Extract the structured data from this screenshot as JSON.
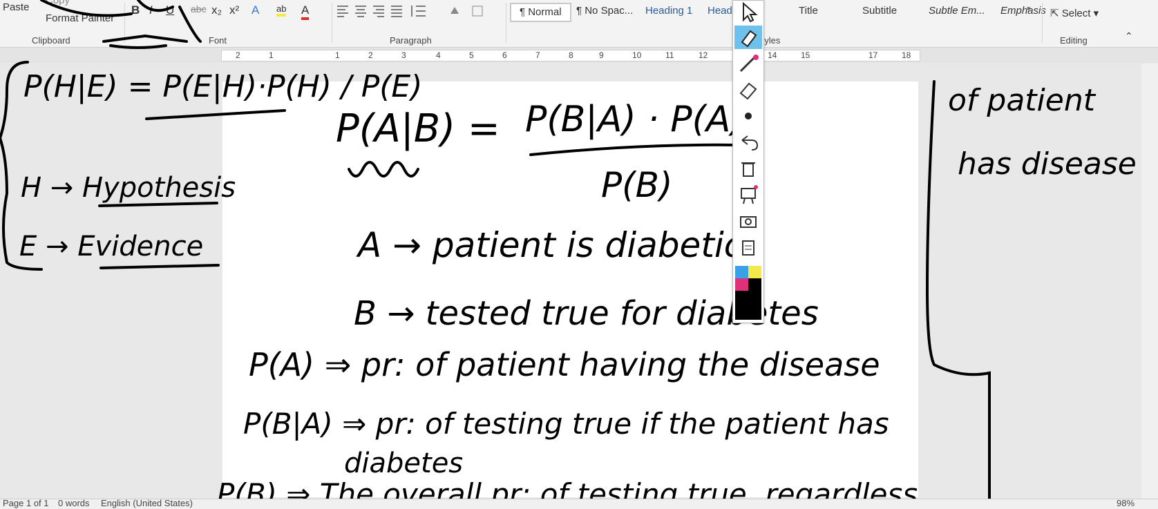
{
  "ribbon": {
    "clipboard": {
      "paste": "Paste",
      "copy": "Copy",
      "format_painter": "Format Painter",
      "label": "Clipboard"
    },
    "font": {
      "label": "Font",
      "bold": "B",
      "italic": "I",
      "underline": "U",
      "strike": "abc",
      "subscript": "x₂",
      "superscript": "x²"
    },
    "paragraph": {
      "label": "Paragraph"
    },
    "styles": {
      "label": "Styles",
      "items": [
        "¶ Normal",
        "¶ No Spac...",
        "Heading 1",
        "Head",
        "Title",
        "Subtitle",
        "Subtle Em...",
        "Emphasis"
      ]
    },
    "editing": {
      "label": "Editing",
      "select": "Select"
    }
  },
  "ruler": {
    "numbers": [
      "2",
      "1",
      "1",
      "2",
      "3",
      "4",
      "5",
      "6",
      "7",
      "8",
      "9",
      "10",
      "11",
      "12",
      "14",
      "15",
      "17",
      "18"
    ]
  },
  "status": {
    "page": "Page 1 of 1",
    "words": "0 words",
    "language": "English (United States)",
    "zoom": "98%"
  },
  "ink": {
    "sidebar_bayes": "P(H|E) = P(E|H)·P(H) / P(E)",
    "h_line": "H → Hypothesis",
    "e_line": "E → Evidence",
    "main_eq_lhs": "P(A|B) =",
    "main_eq_num": "P(B|A) · P(A)",
    "main_eq_den": "P(B)",
    "a_line": "A → patient is diabetic",
    "b_line": "B → tested true for diabetes",
    "pa_line": "P(A) ⇒ pr: of patient having the disease",
    "pba_line": "P(B|A) ⇒ pr: of testing true if the patient has",
    "pba_cont": "diabetes",
    "pb_line": "P(B) ⇒ The overall pr: of testing true, regardless",
    "right_note1": "of patient",
    "right_note2": "has disease"
  },
  "colors": {
    "pen_palette": [
      "#3aa0e8",
      "#f5e94a",
      "#e0307a",
      "#000000"
    ],
    "active_pen": "#6ec1ea"
  }
}
